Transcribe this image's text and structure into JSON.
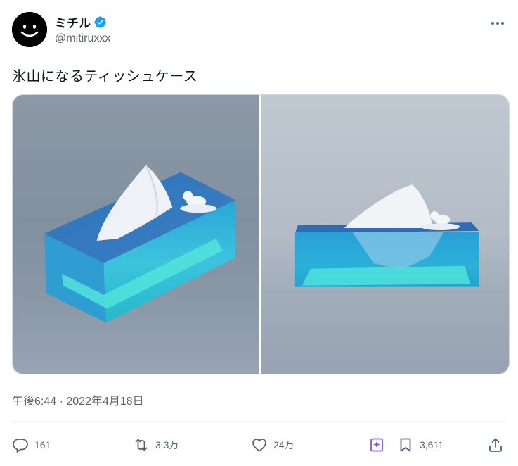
{
  "author": {
    "display_name": "ミチル",
    "handle": "@mitiruxxx",
    "avatar_icon": "smiley-face-icon",
    "verified_icon": "verified-badge-icon",
    "verified_color": "#1d9bf0"
  },
  "tweet": {
    "text": "氷山になるティッシュケース",
    "timestamp": "午後6:44 · 2022年4月18日"
  },
  "media": {
    "images": [
      "iceberg-tissue-box-angled",
      "iceberg-tissue-box-front"
    ]
  },
  "actions": {
    "reply": {
      "icon": "reply-icon",
      "count": "161"
    },
    "retweet": {
      "icon": "retweet-icon",
      "count": "3.3万"
    },
    "like": {
      "icon": "heart-icon",
      "count": "24万"
    },
    "grok": {
      "icon": "grok-icon",
      "color": "#7856ff"
    },
    "bookmark": {
      "icon": "bookmark-icon",
      "count": "3,611"
    },
    "share": {
      "icon": "share-icon"
    }
  },
  "colors": {
    "text_primary": "#0f1419",
    "text_secondary": "#536471",
    "accent": "#1d9bf0"
  }
}
